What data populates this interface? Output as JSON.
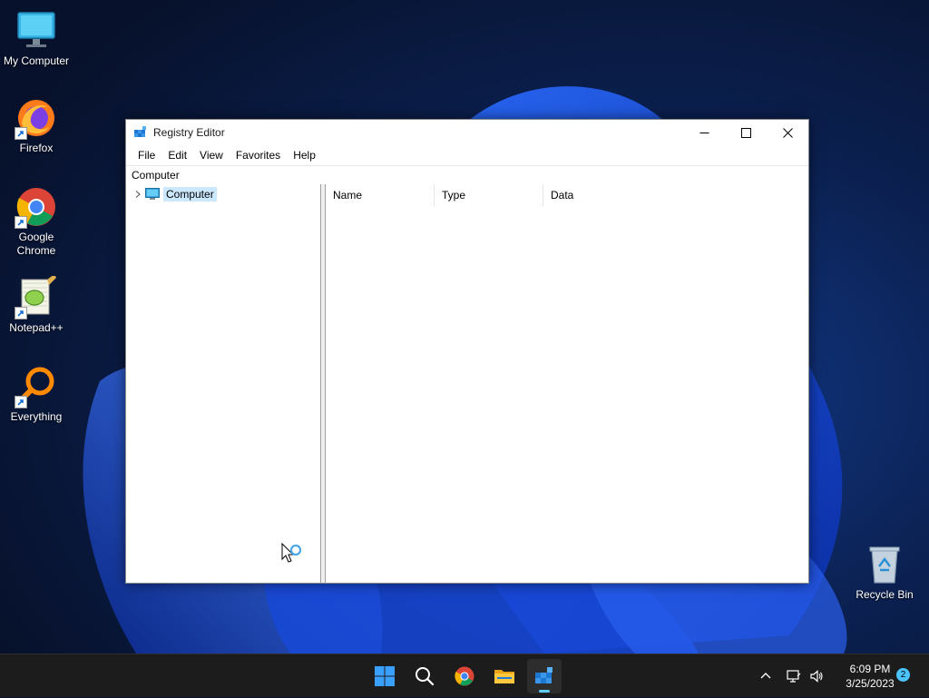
{
  "desktop": {
    "icons": [
      {
        "label": "My Computer",
        "icon": "monitor-icon"
      },
      {
        "label": "Firefox",
        "icon": "firefox-icon"
      },
      {
        "label": "Google Chrome",
        "icon": "chrome-icon"
      },
      {
        "label": "Notepad++",
        "icon": "notepadpp-icon"
      },
      {
        "label": "Everything",
        "icon": "everything-search-icon"
      },
      {
        "label": "Recycle Bin",
        "icon": "recycle-bin-icon"
      }
    ]
  },
  "window": {
    "title": "Registry Editor",
    "menu": [
      "File",
      "Edit",
      "View",
      "Favorites",
      "Help"
    ],
    "address": "Computer",
    "tree": {
      "root_label": "Computer"
    },
    "columns": [
      "Name",
      "Type",
      "Data"
    ]
  },
  "taskbar": {
    "time": "6:09 PM",
    "date": "3/25/2023",
    "notification_count": "2"
  },
  "colors": {
    "accent": "#0067c0",
    "selection": "#cce8ff",
    "taskbar": "#1c1c1c"
  }
}
